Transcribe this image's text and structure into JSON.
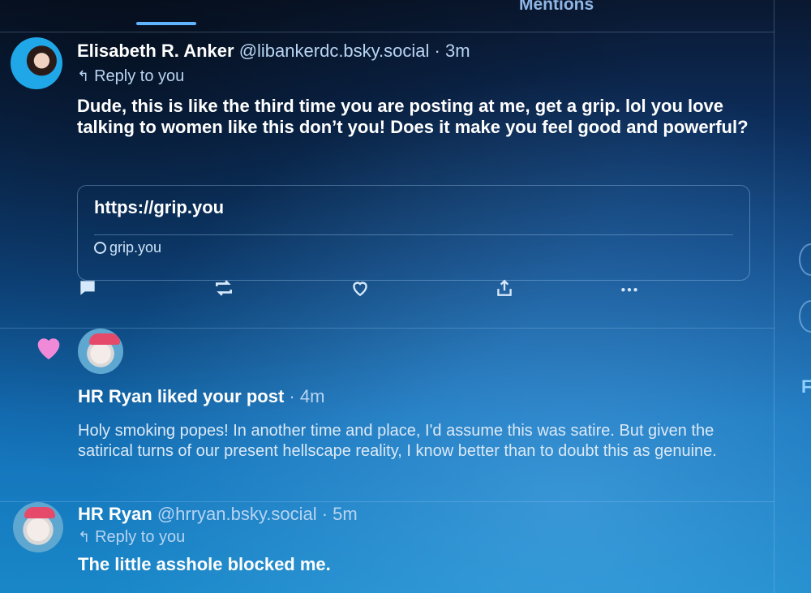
{
  "tabs": {
    "mentions": "Mentions"
  },
  "post1": {
    "author_name": "Elisabeth R. Anker",
    "handle": "@libankerdc.bsky.social",
    "time": "3m",
    "reply_label": "Reply to you",
    "text": "Dude, this is like the third time you are posting at me, get a grip. lol you love talking to women like this don’t you! Does it make you feel good and powerful?",
    "link_card": {
      "title": "https://grip.you",
      "domain": "grip.you"
    }
  },
  "notification": {
    "actor": "HR Ryan",
    "action_text": "liked your post",
    "time": "4m",
    "text": "Holy smoking popes! In another time and place, I'd assume this was satire. But given the satirical turns of our present hellscape reality, I know better than to doubt this as genuine."
  },
  "post2": {
    "author_name": "HR Ryan",
    "handle": "@hrryan.bsky.social",
    "time": "5m",
    "reply_label": "Reply to you",
    "text": "The little asshole blocked me."
  },
  "icons": {
    "reply": "reply-bubble-icon",
    "repost": "repost-icon",
    "like": "heart-icon",
    "share": "share-icon",
    "more": "more-dots-icon",
    "like_notification": "filled-heart-icon"
  },
  "colors": {
    "accent": "#5fb3ff",
    "like": "#f08ad8",
    "background": "#0f4a8a"
  },
  "edge": {
    "letter": "F"
  }
}
